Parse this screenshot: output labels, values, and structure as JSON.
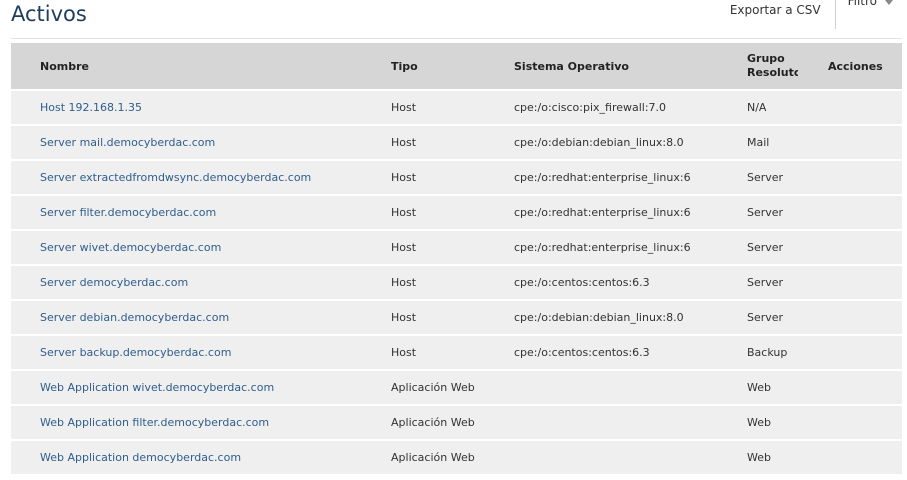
{
  "header": {
    "title": "Activos",
    "export_label": "Exportar a CSV",
    "filter_label": "Filtro"
  },
  "table": {
    "columns": {
      "name": "Nombre",
      "type": "Tipo",
      "os": "Sistema Operativo",
      "group_line1": "Grupo",
      "group_line2": "Resolutor",
      "actions": "Acciones"
    },
    "rows": [
      {
        "name": "Host 192.168.1.35",
        "type": "Host",
        "os": "cpe:/o:cisco:pix_firewall:7.0",
        "group": "N/A"
      },
      {
        "name": "Server mail.democyberdac.com",
        "type": "Host",
        "os": "cpe:/o:debian:debian_linux:8.0",
        "group": "Mail"
      },
      {
        "name": "Server extractedfromdwsync.democyberdac.com",
        "type": "Host",
        "os": "cpe:/o:redhat:enterprise_linux:6",
        "group": "Server"
      },
      {
        "name": "Server filter.democyberdac.com",
        "type": "Host",
        "os": "cpe:/o:redhat:enterprise_linux:6",
        "group": "Server"
      },
      {
        "name": "Server wivet.democyberdac.com",
        "type": "Host",
        "os": "cpe:/o:redhat:enterprise_linux:6",
        "group": "Server"
      },
      {
        "name": "Server democyberdac.com",
        "type": "Host",
        "os": "cpe:/o:centos:centos:6.3",
        "group": "Server"
      },
      {
        "name": "Server debian.democyberdac.com",
        "type": "Host",
        "os": "cpe:/o:debian:debian_linux:8.0",
        "group": "Server"
      },
      {
        "name": "Server backup.democyberdac.com",
        "type": "Host",
        "os": "cpe:/o:centos:centos:6.3",
        "group": "Backup"
      },
      {
        "name": "Web Application wivet.democyberdac.com",
        "type": "Aplicación Web",
        "os": "",
        "group": "Web"
      },
      {
        "name": "Web Application filter.democyberdac.com",
        "type": "Aplicación Web",
        "os": "",
        "group": "Web"
      },
      {
        "name": "Web Application democyberdac.com",
        "type": "Aplicación Web",
        "os": "",
        "group": "Web"
      }
    ]
  }
}
